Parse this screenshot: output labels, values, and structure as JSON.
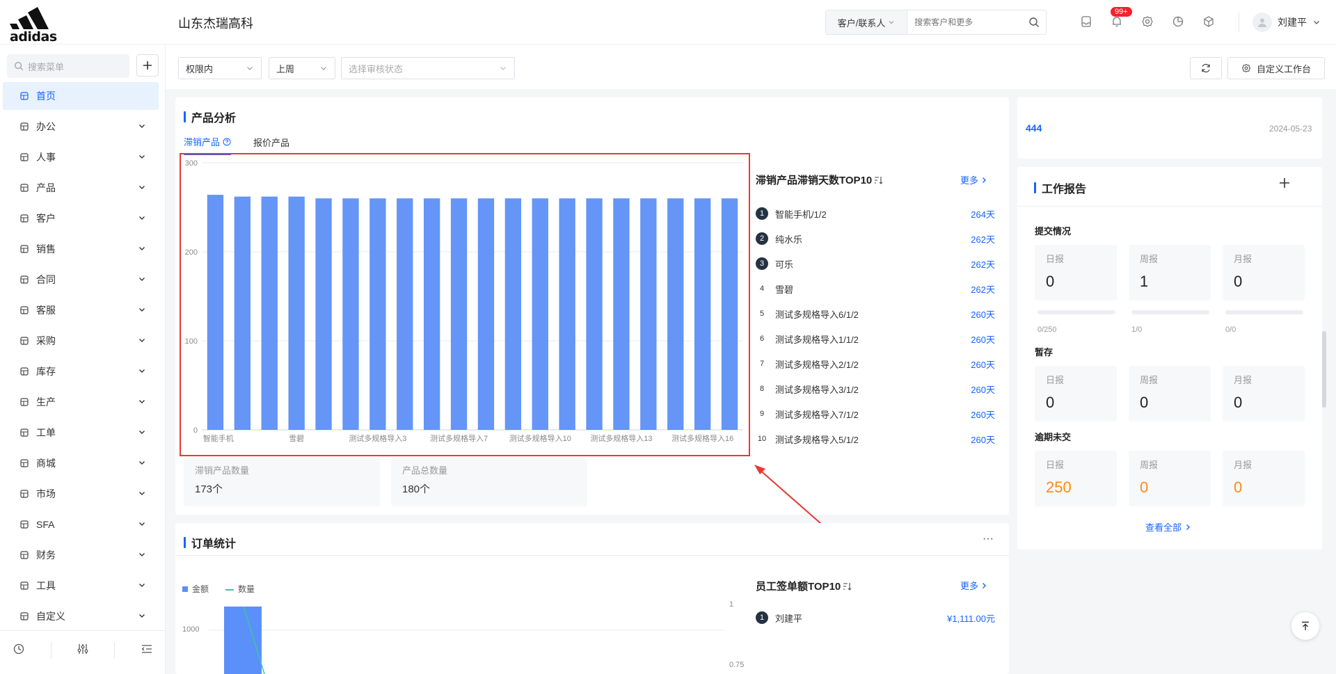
{
  "app": {
    "company": "山东杰瑞高科",
    "logo_text": "adidas"
  },
  "topbar": {
    "search_type": "客户/联系人",
    "search_placeholder": "搜索客户和更多",
    "notification_badge": "99+",
    "user_name": "刘建平"
  },
  "sidebar": {
    "search_placeholder": "搜索菜单",
    "items": [
      {
        "label": "首页",
        "icon": "home-icon",
        "active": true
      },
      {
        "label": "办公",
        "icon": "office-icon"
      },
      {
        "label": "人事",
        "icon": "people-icon"
      },
      {
        "label": "产品",
        "icon": "cube-icon"
      },
      {
        "label": "客户",
        "icon": "customer-icon"
      },
      {
        "label": "销售",
        "icon": "sales-icon"
      },
      {
        "label": "合同",
        "icon": "contract-icon"
      },
      {
        "label": "客服",
        "icon": "headset-icon"
      },
      {
        "label": "采购",
        "icon": "bag-icon"
      },
      {
        "label": "库存",
        "icon": "warehouse-icon"
      },
      {
        "label": "生产",
        "icon": "factory-icon"
      },
      {
        "label": "工单",
        "icon": "ticket-icon"
      },
      {
        "label": "商城",
        "icon": "mall-icon"
      },
      {
        "label": "市场",
        "icon": "market-icon"
      },
      {
        "label": "SFA",
        "icon": "sfa-icon"
      },
      {
        "label": "财务",
        "icon": "finance-icon"
      },
      {
        "label": "工具",
        "icon": "toolbox-icon"
      },
      {
        "label": "自定义",
        "icon": "grid-icon"
      }
    ]
  },
  "filters": {
    "scope": "权限内",
    "period": "上周",
    "audit_placeholder": "选择审核状态",
    "custom_workbench": "自定义工作台"
  },
  "product_analysis": {
    "title": "产品分析",
    "tabs": [
      "滞销产品",
      "报价产品"
    ],
    "stats": [
      {
        "label": "滞销产品数量",
        "value": "173个"
      },
      {
        "label": "产品总数量",
        "value": "180个"
      }
    ],
    "ranking_title": "滞销产品滞销天数TOP10",
    "more_label": "更多",
    "ranking": [
      {
        "rank": "1",
        "name": "智能手机/1/2",
        "value": "264天"
      },
      {
        "rank": "2",
        "name": "纯水乐",
        "value": "262天"
      },
      {
        "rank": "3",
        "name": "可乐",
        "value": "262天"
      },
      {
        "rank": "4",
        "name": "雪碧",
        "value": "262天"
      },
      {
        "rank": "5",
        "name": "测试多规格导入6/1/2",
        "value": "260天"
      },
      {
        "rank": "6",
        "name": "测试多规格导入1/1/2",
        "value": "260天"
      },
      {
        "rank": "7",
        "name": "测试多规格导入2/1/2",
        "value": "260天"
      },
      {
        "rank": "8",
        "name": "测试多规格导入3/1/2",
        "value": "260天"
      },
      {
        "rank": "9",
        "name": "测试多规格导入7/1/2",
        "value": "260天"
      },
      {
        "rank": "10",
        "name": "测试多规格导入5/1/2",
        "value": "260天"
      }
    ]
  },
  "chart_data": {
    "type": "bar",
    "categories": [
      "智能手机",
      "",
      "",
      "雪碧",
      "",
      "",
      "测试多规格导入3",
      "",
      "",
      "测试多规格导入7",
      "",
      "",
      "测试多规格导入10",
      "",
      "",
      "测试多规格导入13",
      "",
      "",
      "测试多规格导入16",
      ""
    ],
    "series": [
      {
        "values": [
          264,
          262,
          262,
          262,
          260,
          260,
          260,
          260,
          260,
          260,
          260,
          260,
          260,
          260,
          260,
          260,
          260,
          260,
          260,
          260
        ]
      }
    ],
    "yticks": [
      "0",
      "100",
      "200",
      "300"
    ],
    "ylim": [
      0,
      300
    ],
    "color": "#6495f7",
    "grid": true
  },
  "order_stats": {
    "title": "订单统计",
    "menu_glyph": "···",
    "legend": [
      "金额",
      "数量"
    ],
    "left_tick": "1000",
    "right_ticks": [
      "1",
      "0.75"
    ],
    "ranking_title": "员工签单额TOP10",
    "more_label": "更多",
    "ranking": [
      {
        "rank": "1",
        "name": "刘建平",
        "value": "¥1,111.00元"
      }
    ]
  },
  "right_panel": {
    "link_text": "444",
    "date": "2024-05-23",
    "report_title": "工作报告",
    "submitted": {
      "label": "提交情况",
      "items": [
        {
          "name": "日报",
          "value": "0",
          "progress_text": "0/250",
          "progress": 0
        },
        {
          "name": "周报",
          "value": "1",
          "progress_text": "1/0",
          "progress": 0
        },
        {
          "name": "月报",
          "value": "0",
          "progress_text": "0/0",
          "progress": 0
        }
      ]
    },
    "draft": {
      "label": "暂存",
      "items": [
        {
          "name": "日报",
          "value": "0"
        },
        {
          "name": "周报",
          "value": "0"
        },
        {
          "name": "月报",
          "value": "0"
        }
      ]
    },
    "overdue": {
      "label": "逾期未交",
      "items": [
        {
          "name": "日报",
          "value": "250"
        },
        {
          "name": "周报",
          "value": "0"
        },
        {
          "name": "月报",
          "value": "0"
        }
      ]
    },
    "view_all": "查看全部"
  }
}
